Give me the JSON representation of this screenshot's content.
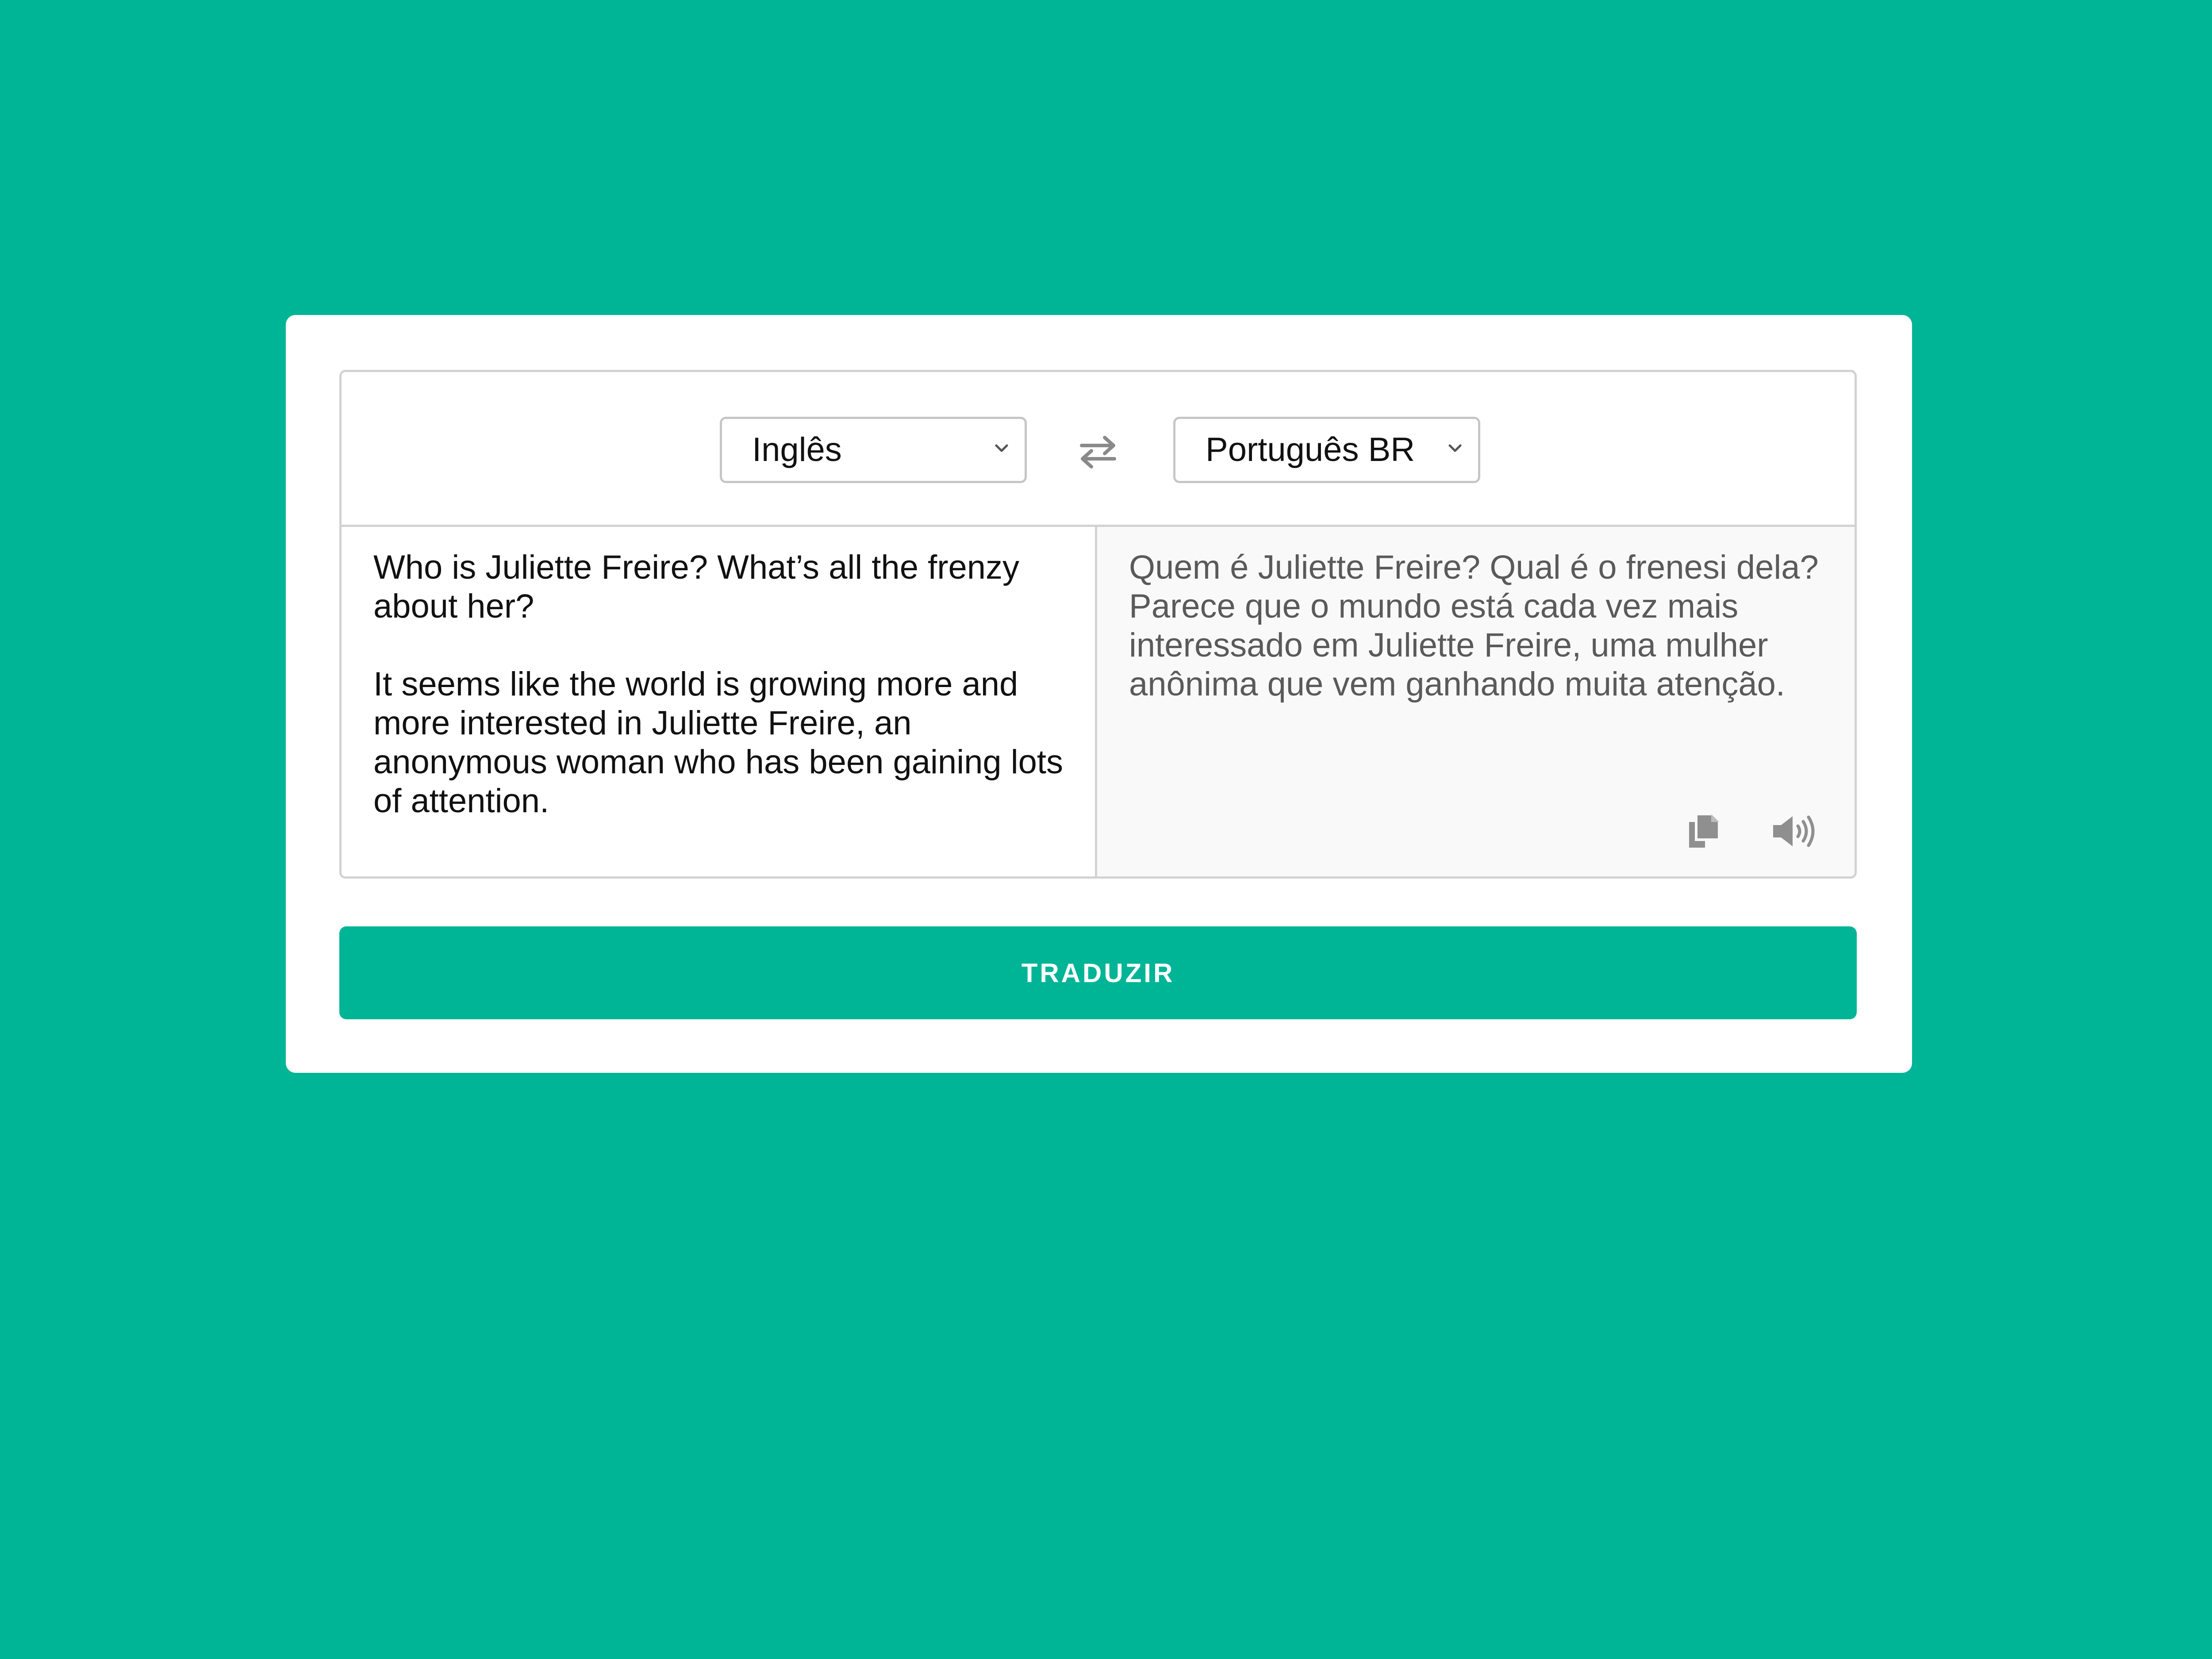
{
  "source_language": {
    "selected": "Inglês"
  },
  "target_language": {
    "selected": "Português BR"
  },
  "source_text": {
    "paragraph_1": "Who is Juliette Freire? What’s all the frenzy about her?",
    "paragraph_2": "It seems like the world is growing more and more interested in Juliette Freire, an anonymous woman who has been gaining lots of attention."
  },
  "translated_text": {
    "value": "Quem é Juliette Freire? Qual é o frenesi dela?Parece que o mundo está cada vez mais interessado em Juliette Freire, uma mulher anônima que vem ganhando muita atenção."
  },
  "icons": {
    "swap": "swap-arrows-icon",
    "copy": "copy-icon",
    "speaker": "speaker-icon",
    "dropdown": "chevron-down-icon"
  },
  "translate_button": {
    "label": "TRADUZIR"
  },
  "colors": {
    "background": "#00b496",
    "button": "#00b496",
    "card": "#ffffff",
    "spellcheck_underline": "#e03030"
  }
}
